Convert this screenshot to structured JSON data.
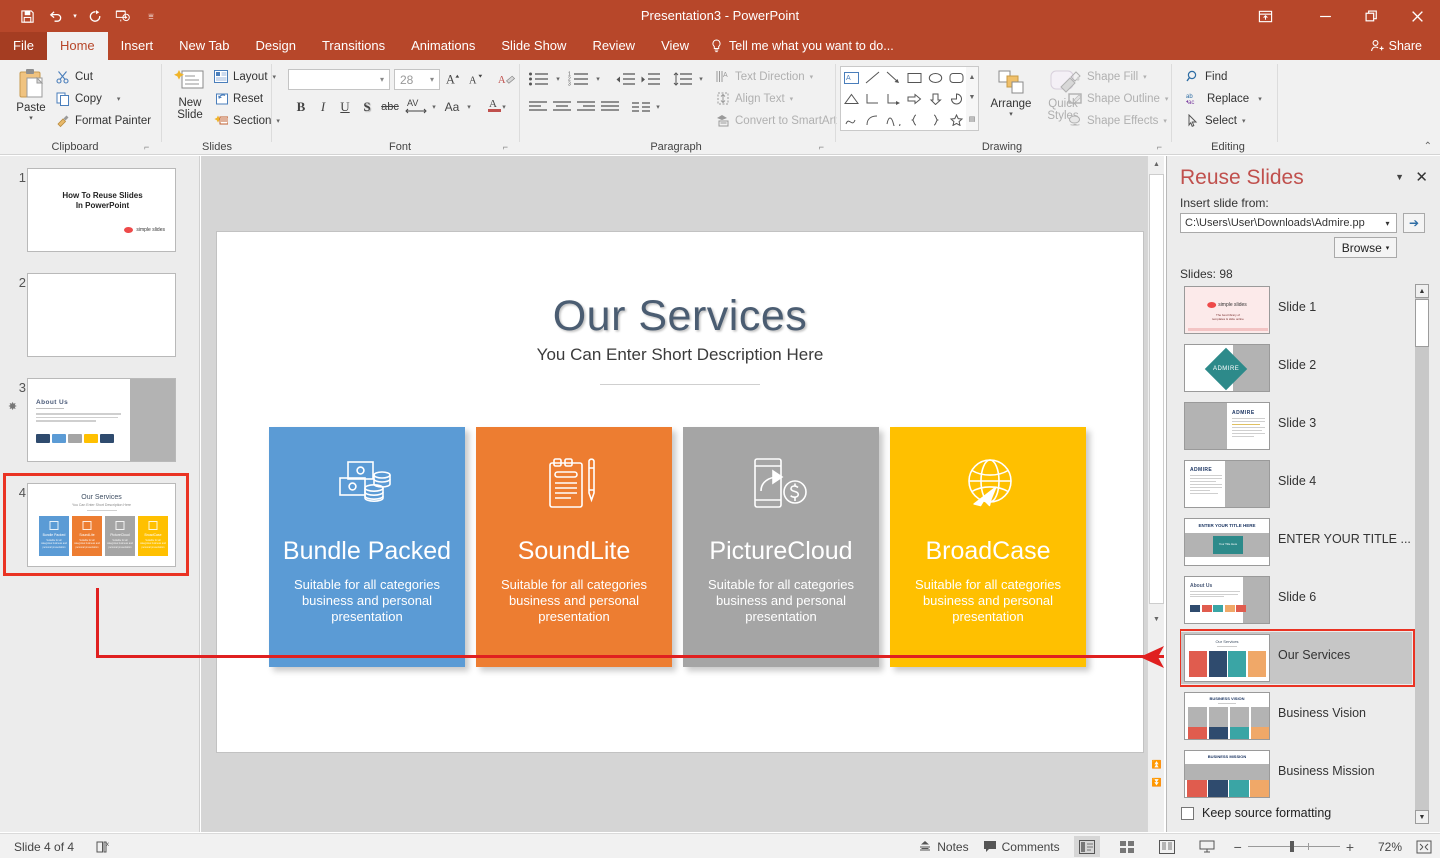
{
  "window": {
    "title": "Presentation3 - PowerPoint",
    "quick_access": [
      "save-icon",
      "undo-icon",
      "redo-icon",
      "start-slideshow-icon",
      "customize-qat-icon"
    ],
    "controls": [
      "ribbon-display-options-icon",
      "minimize-icon",
      "restore-icon",
      "close-icon"
    ]
  },
  "tabs": [
    {
      "label": "File",
      "active": false
    },
    {
      "label": "Home",
      "active": true
    },
    {
      "label": "Insert",
      "active": false
    },
    {
      "label": "New Tab",
      "active": false
    },
    {
      "label": "Design",
      "active": false
    },
    {
      "label": "Transitions",
      "active": false
    },
    {
      "label": "Animations",
      "active": false
    },
    {
      "label": "Slide Show",
      "active": false
    },
    {
      "label": "Review",
      "active": false
    },
    {
      "label": "View",
      "active": false
    }
  ],
  "tellme": {
    "label": "Tell me what you want to do...",
    "icon": "lightbulb-icon"
  },
  "share": {
    "label": "Share",
    "icon": "person-add-icon"
  },
  "ribbon": {
    "clipboard": {
      "name": "Clipboard",
      "paste": "Paste",
      "items": [
        {
          "label": "Cut",
          "icon": "scissors-icon"
        },
        {
          "label": "Copy",
          "icon": "copy-icon"
        },
        {
          "label": "Format Painter",
          "icon": "paintbrush-icon"
        }
      ]
    },
    "slides": {
      "name": "Slides",
      "new_slide": "New\nSlide",
      "new_slide_line1": "New",
      "new_slide_line2": "Slide",
      "items": [
        {
          "label": "Layout",
          "icon": "layout-icon"
        },
        {
          "label": "Reset",
          "icon": "reset-icon"
        },
        {
          "label": "Section",
          "icon": "section-icon"
        }
      ]
    },
    "font": {
      "name": "Font",
      "font_name": "",
      "font_size": "28",
      "buttons": [
        "B",
        "I",
        "U",
        "S",
        "abc"
      ]
    },
    "paragraph": {
      "name": "Paragraph",
      "items": [
        {
          "label": "Text Direction",
          "icon": "text-direction-icon"
        },
        {
          "label": "Align Text",
          "icon": "align-text-icon"
        },
        {
          "label": "Convert to SmartArt",
          "icon": "smartart-icon"
        }
      ]
    },
    "drawing": {
      "name": "Drawing",
      "arrange": "Arrange",
      "quick_styles_line1": "Quick",
      "quick_styles_line2": "Styles",
      "items": [
        {
          "label": "Shape Fill",
          "icon": "shape-fill-icon"
        },
        {
          "label": "Shape Outline",
          "icon": "shape-outline-icon"
        },
        {
          "label": "Shape Effects",
          "icon": "shape-effects-icon"
        }
      ]
    },
    "editing": {
      "name": "Editing",
      "items": [
        {
          "label": "Find",
          "icon": "search-icon"
        },
        {
          "label": "Replace",
          "icon": "replace-icon"
        },
        {
          "label": "Select",
          "icon": "cursor-icon"
        }
      ]
    }
  },
  "thumbnails": [
    {
      "number": "1",
      "title_line1": "How To Reuse Slides",
      "title_line2": "In PowerPoint",
      "logo": "simple slides",
      "selected": false,
      "starred": false
    },
    {
      "number": "2",
      "selected": false,
      "starred": false
    },
    {
      "number": "3",
      "heading": "About Us",
      "selected": false,
      "starred": true
    },
    {
      "number": "4",
      "title": "Our Services",
      "selected": true,
      "starred": false
    }
  ],
  "slide": {
    "title": "Our Services",
    "subtitle": "You Can Enter Short Description Here",
    "cards": [
      {
        "name": "Bundle Packed",
        "desc": "Suitable for all categories business and personal presentation",
        "color": "#5b9bd5",
        "icon": "money-bundle-icon"
      },
      {
        "name": "SoundLite",
        "desc": "Suitable for all categories business and personal presentation",
        "color": "#ed7d31",
        "icon": "clipboard-pen-icon"
      },
      {
        "name": "PictureCloud",
        "desc": "Suitable for all categories business and personal presentation",
        "color": "#a5a5a5",
        "icon": "mobile-payment-icon"
      },
      {
        "name": "BroadCase",
        "desc": "Suitable for all categories business and personal presentation",
        "color": "#ffc000",
        "icon": "globe-arrow-icon"
      }
    ]
  },
  "reuse_pane": {
    "title": "Reuse Slides",
    "insert_label": "Insert slide from:",
    "path_value": "C:\\Users\\User\\Downloads\\Admire.pp",
    "go_icon": "arrow-right-icon",
    "browse_label": "Browse",
    "slides_count": "Slides: 98",
    "keep_source_formatting": "Keep source formatting",
    "items": [
      {
        "label": "Slide 1",
        "kind": "cover",
        "selected": false
      },
      {
        "label": "Slide 2",
        "kind": "diamond",
        "selected": false
      },
      {
        "label": "Slide 3",
        "kind": "text-right",
        "selected": false
      },
      {
        "label": "Slide 4",
        "kind": "text-left",
        "selected": false
      },
      {
        "label": "ENTER YOUR TITLE ...",
        "kind": "title-badge",
        "selected": false
      },
      {
        "label": "Slide 6",
        "kind": "about",
        "selected": false
      },
      {
        "label": "Our Services",
        "kind": "services",
        "selected": true
      },
      {
        "label": "Business Vision",
        "kind": "vision",
        "selected": false
      },
      {
        "label": "Business Mission",
        "kind": "mission",
        "selected": false
      }
    ]
  },
  "status": {
    "slide_counter": "Slide 4 of 4",
    "language_icon": "proofing-icon",
    "notes": "Notes",
    "comments": "Comments",
    "zoom_percent": "72%",
    "views": [
      "normal-view-icon",
      "slide-sorter-icon",
      "reading-view-icon",
      "slideshow-view-icon"
    ],
    "fit_icon": "fit-to-window-icon"
  }
}
